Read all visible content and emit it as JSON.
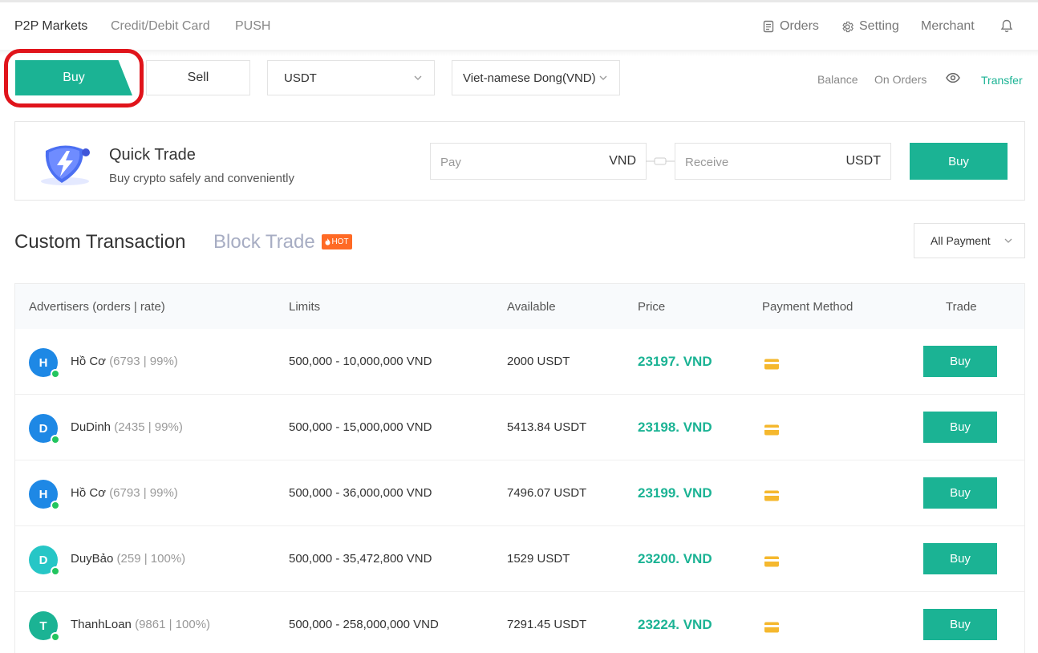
{
  "nav": {
    "tabs": [
      {
        "label": "P2P Markets",
        "active": true
      },
      {
        "label": "Credit/Debit Card",
        "active": false
      },
      {
        "label": "PUSH",
        "active": false
      }
    ],
    "orders": "Orders",
    "setting": "Setting",
    "merchant": "Merchant",
    "icons": [
      "orders-icon",
      "gear-icon",
      "bell-icon"
    ]
  },
  "toolbar": {
    "buy": "Buy",
    "sell": "Sell",
    "crypto": "USDT",
    "fiat": "Viet-namese Dong(VND)",
    "balance": "Balance",
    "on_orders": "On Orders",
    "transfer": "Transfer"
  },
  "quick_trade": {
    "title": "Quick Trade",
    "subtitle": "Buy crypto safely and conveniently",
    "pay_placeholder": "Pay",
    "pay_currency": "VND",
    "receive_placeholder": "Receive",
    "receive_currency": "USDT",
    "buy": "Buy"
  },
  "section": {
    "title": "Custom Transaction",
    "block_trade": "Block Trade",
    "hot": "HOT",
    "payment_filter": "All Payment"
  },
  "table": {
    "headers": {
      "advertisers": "Advertisers (orders | rate)",
      "limits": "Limits",
      "available": "Available",
      "price": "Price",
      "payment": "Payment Method",
      "trade": "Trade"
    },
    "rows": [
      {
        "initial": "H",
        "name": "Hồ Cơ",
        "stats": "(6793 | 99%)",
        "limits": "500,000 -  10,000,000 VND",
        "available": "2000 USDT",
        "price": "23197. VND",
        "trade": "Buy",
        "avatar_color": "#1e88e5"
      },
      {
        "initial": "D",
        "name": "DuDinh",
        "stats": "(2435 | 99%)",
        "limits": "500,000 -  15,000,000 VND",
        "available": "5413.84 USDT",
        "price": "23198. VND",
        "trade": "Buy",
        "avatar_color": "#1e88e5"
      },
      {
        "initial": "H",
        "name": "Hồ Cơ",
        "stats": "(6793 | 99%)",
        "limits": "500,000 -  36,000,000 VND",
        "available": "7496.07 USDT",
        "price": "23199. VND",
        "trade": "Buy",
        "avatar_color": "#1e88e5"
      },
      {
        "initial": "D",
        "name": "DuyBảo",
        "stats": "(259 | 100%)",
        "limits": "500,000 -  35,472,800 VND",
        "available": "1529 USDT",
        "price": "23200. VND",
        "trade": "Buy",
        "avatar_color": "#26c6c6"
      },
      {
        "initial": "T",
        "name": "ThanhLoan",
        "stats": "(9861 | 100%)",
        "limits": "500,000 -  258,000,000 VND",
        "available": "7291.45 USDT",
        "price": "23224. VND",
        "trade": "Buy",
        "avatar_color": "#1bb394"
      }
    ]
  },
  "colors": {
    "accent": "#1bb394",
    "highlight_ring": "#e0141b",
    "hot": "#ff6a25",
    "card_icon": "#f5b82e"
  }
}
